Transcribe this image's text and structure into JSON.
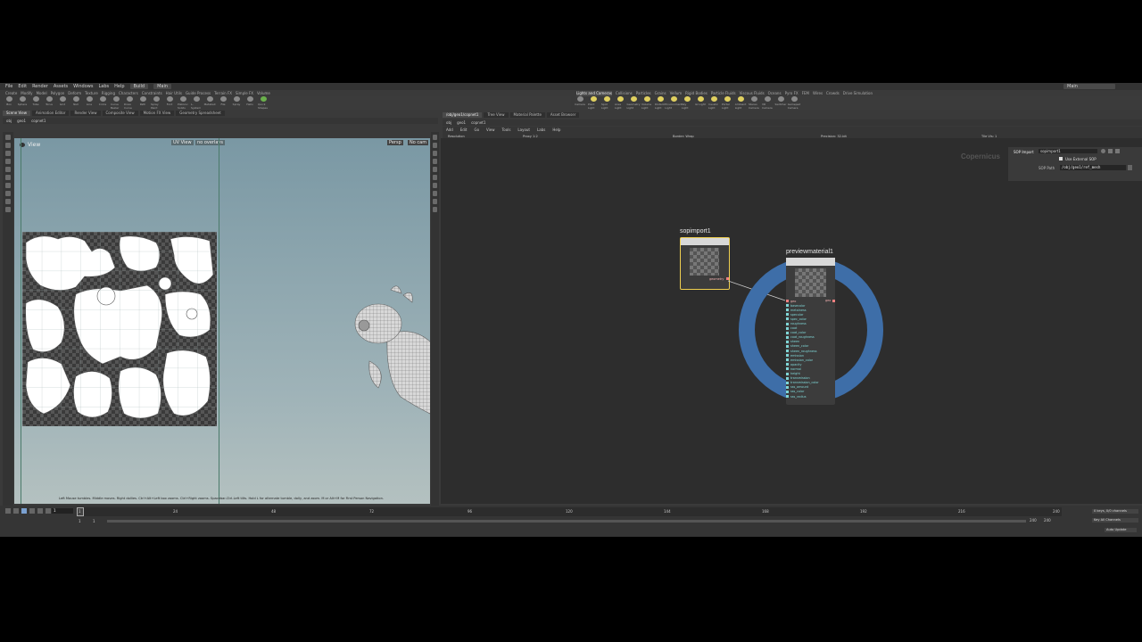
{
  "menu": [
    "File",
    "Edit",
    "Render",
    "Assets",
    "Windows",
    "Labs",
    "Help"
  ],
  "desktops": {
    "build": "Build",
    "main": "Main",
    "right": "Main"
  },
  "shelf_tabs_left": [
    "Create",
    "Modify",
    "Model",
    "Polygon",
    "Deform",
    "Texture",
    "Rigging",
    "Characters",
    "Constraints",
    "Hair Utils",
    "Guide Process",
    "Terrain FX",
    "Simple FX",
    "Volume"
  ],
  "shelf_tools_left": [
    "Box",
    "Sphere",
    "Tube",
    "Torus",
    "Grid",
    "Null",
    "Line",
    "Circle",
    "Curve Bezier",
    "Draw Curve",
    "Path",
    "Spray Paint",
    "Font",
    "Platonic Solids",
    "L-System",
    "Metaball",
    "File",
    "Spray",
    "Hello",
    "Quick Shapes"
  ],
  "shelf_tabs_right": [
    "Lights and Cameras",
    "Collisions",
    "Particles",
    "Grains",
    "Vellum",
    "Rigid Bodies",
    "Particle Fluids",
    "Viscous Fluids",
    "Oceans",
    "Pyro FX",
    "FEM",
    "Wires",
    "Crowds",
    "Drive Simulation"
  ],
  "shelf_tools_right": [
    "Camera",
    "Point Light",
    "Spot Light",
    "Area Light",
    "Geometry Light",
    "Volume Light",
    "Distant Light",
    "Environment Light",
    "Sky Light",
    "GI Light",
    "Caustic Light",
    "Portal Light",
    "Ambient Light",
    "Stereo Camera",
    "VR Camera",
    "Switcher",
    "Gamepad Camera"
  ],
  "left_tabs": [
    "Scene View",
    "Animation Editor",
    "Render View",
    "Composite View",
    "Motion FX View",
    "Geometry Spreadsheet"
  ],
  "left_path": [
    "obj",
    "geo1",
    "copnet1"
  ],
  "viewport": {
    "label": "View",
    "uv_label": "UV View",
    "cam1": "Persp",
    "cam2": "No cam",
    "overlay1": "UV View",
    "overlay2": "no overlays"
  },
  "status_line": "Left Mouse tumbles. Middle moves. Right dollies. Ctrl+Alt+Left box zooms. Ctrl+Right zooms. Spacebar-Ctrl-Left tilts. Hold L for alternate tumble, dolly, and zoom.  M or Alt+M for First Person Navigation.",
  "right_tabs": [
    "/obj/geo1/copnet1",
    "Tree View",
    "Material Palette",
    "Asset Browser"
  ],
  "right_path": [
    "obj",
    "geo1",
    "copnet1"
  ],
  "net_menu": [
    "Add",
    "Edit",
    "Go",
    "View",
    "Tools",
    "Layout",
    "Labs",
    "Help"
  ],
  "net_info": {
    "resolution": "Resolution",
    "proxy": "Proxy 1:2",
    "border": "Border: Wrap",
    "precision": "Precision: 32-bit",
    "tile": "Tile Vis: 1"
  },
  "context_label": "Copernicus",
  "params": {
    "type": "SOP Import",
    "name": "sopimport1",
    "use_external": "Use External SOP",
    "path_label": "SOP Path",
    "path_value": "/obj/geo1/ref_mesh"
  },
  "nodes": {
    "sopimport": {
      "name": "sopimport1",
      "output": "geometry"
    },
    "preview": {
      "name": "previewmaterial1",
      "output": "geo",
      "inputs": [
        "geo",
        "basecolor",
        "metalness",
        "specular",
        "spec_color",
        "roughness",
        "coat",
        "coat_color",
        "coat_roughness",
        "sheen",
        "sheen_color",
        "sheen_roughness",
        "emission",
        "emission_color",
        "opacity",
        "normal",
        "height",
        "transmission",
        "transmission_color",
        "sss_amount",
        "sss_color",
        "sss_radius"
      ]
    }
  },
  "timeline": {
    "frame": "1",
    "start": "1",
    "end": "1",
    "ticks": [
      "1",
      "24",
      "48",
      "72",
      "96",
      "120",
      "144",
      "168",
      "192",
      "216",
      "240"
    ],
    "range_end": "240",
    "range_end2": "240",
    "keys": "0 keys, 0/0 channels",
    "keyall": "Key All Channels",
    "auto": "Auto Update"
  },
  "colors": {
    "ring": "#3e6ea8",
    "accent": "#ffd24a",
    "port": "#7fd6d6"
  }
}
